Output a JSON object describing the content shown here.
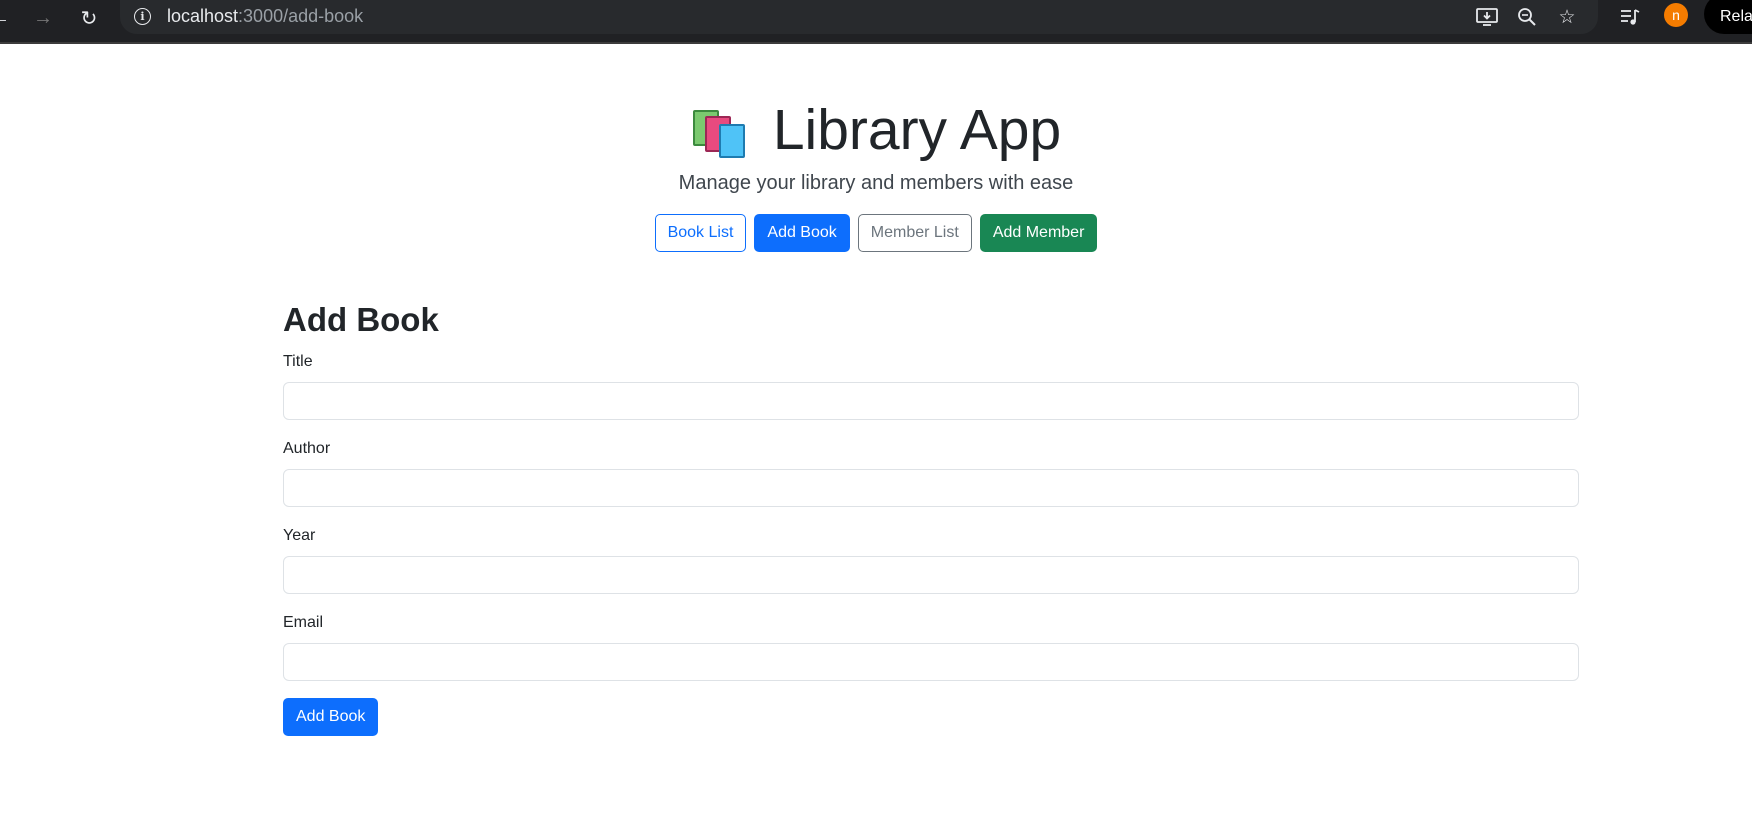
{
  "browser": {
    "url_host": "localhost",
    "url_path": ":3000/add-book",
    "profile_initial": "n",
    "relaunch_label": "Relau"
  },
  "app": {
    "title": "Library App",
    "subtitle": "Manage your library and members with ease",
    "nav": {
      "book_list": "Book List",
      "add_book": "Add Book",
      "member_list": "Member List",
      "add_member": "Add Member"
    }
  },
  "form": {
    "heading": "Add Book",
    "fields": [
      {
        "label": "Title",
        "value": ""
      },
      {
        "label": "Author",
        "value": ""
      },
      {
        "label": "Year",
        "value": ""
      },
      {
        "label": "Email",
        "value": ""
      }
    ],
    "submit_label": "Add Book"
  },
  "colors": {
    "primary": "#0d6efd",
    "secondary": "#6c757d",
    "success": "#198754"
  }
}
